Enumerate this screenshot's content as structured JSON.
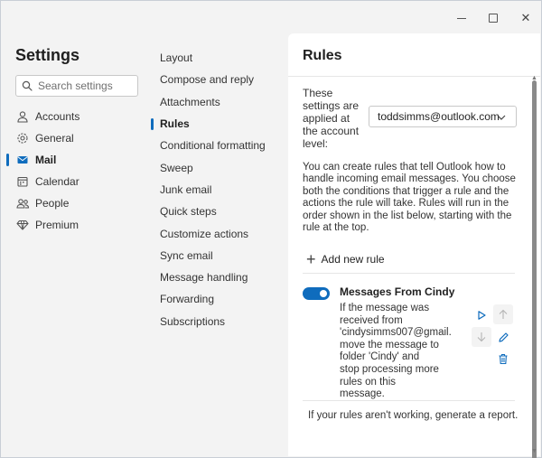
{
  "titlebar": {
    "minimize": "minimize-icon",
    "maximize": "maximize-icon",
    "close": "✕"
  },
  "settings": {
    "title": "Settings",
    "search_placeholder": "Search settings",
    "nav": [
      {
        "label": "Accounts",
        "icon": "person-icon",
        "active": false
      },
      {
        "label": "General",
        "icon": "gear-icon",
        "active": false
      },
      {
        "label": "Mail",
        "icon": "mail-icon",
        "active": true
      },
      {
        "label": "Calendar",
        "icon": "calendar-icon",
        "active": false
      },
      {
        "label": "People",
        "icon": "people-icon",
        "active": false
      },
      {
        "label": "Premium",
        "icon": "diamond-icon",
        "active": false
      }
    ]
  },
  "mail_menu": {
    "items": [
      {
        "label": "Layout"
      },
      {
        "label": "Compose and reply"
      },
      {
        "label": "Attachments"
      },
      {
        "label": "Rules",
        "active": true
      },
      {
        "label": "Conditional formatting"
      },
      {
        "label": "Sweep"
      },
      {
        "label": "Junk email"
      },
      {
        "label": "Quick steps"
      },
      {
        "label": "Customize actions"
      },
      {
        "label": "Sync email"
      },
      {
        "label": "Message handling"
      },
      {
        "label": "Forwarding"
      },
      {
        "label": "Subscriptions"
      }
    ]
  },
  "rules": {
    "title": "Rules",
    "account_text": "These settings are applied at the account level:",
    "account_value": "toddsimms@outlook.com",
    "description": "You can create rules that tell Outlook how to handle incoming email messages. You choose both the conditions that trigger a rule and the actions the rule will take. Rules will run in the order shown in the list below, starting with the rule at the top.",
    "add_label": "Add new rule",
    "rule": {
      "enabled": true,
      "name": "Messages From Cindy",
      "description": "If the message was received from 'cindysimms007@gmail. move the message to folder 'Cindy' and stop processing more rules on this message."
    },
    "footer": "If your rules aren't working, generate a report."
  },
  "colors": {
    "accent": "#0f6cbd",
    "background": "#f3f3f3",
    "panel": "#ffffff"
  }
}
